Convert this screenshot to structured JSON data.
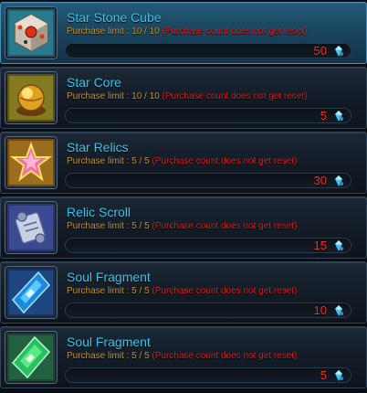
{
  "shop": {
    "limit_label": "Purchase limit : ",
    "reset_note": "(Purchase count does not get reset)",
    "items": [
      {
        "name": "Star Stone Cube",
        "limit": "10 / 10",
        "price": "50",
        "icon": "star-stone-cube-icon"
      },
      {
        "name": "Star Core",
        "limit": "10 / 10",
        "price": "5",
        "icon": "star-core-icon"
      },
      {
        "name": "Star Relics",
        "limit": "5 / 5",
        "price": "30",
        "icon": "star-relics-icon"
      },
      {
        "name": "Relic Scroll",
        "limit": "5 / 5",
        "price": "15",
        "icon": "relic-scroll-icon"
      },
      {
        "name": "Soul Fragment",
        "limit": "5 / 5",
        "price": "10",
        "icon": "soul-fragment-blue-icon"
      },
      {
        "name": "Soul Fragment",
        "limit": "5 / 5",
        "price": "5",
        "icon": "soul-fragment-green-icon"
      }
    ]
  },
  "colors": {
    "name": "#34c6ec",
    "limit_label": "#c4922c",
    "reset_note": "#e01818",
    "price": "#ff2828",
    "selected_row": "#1b4660"
  },
  "currency_icon": "crystal-gem-icon"
}
